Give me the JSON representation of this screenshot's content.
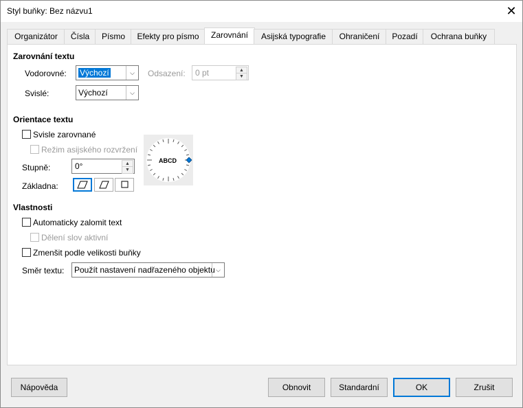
{
  "window": {
    "title": "Styl buňky: Bez názvu1",
    "close_glyph": "✕"
  },
  "tabs": [
    {
      "label": "Organizátor"
    },
    {
      "label": "Čísla"
    },
    {
      "label": "Písmo"
    },
    {
      "label": "Efekty pro písmo"
    },
    {
      "label": "Zarovnání",
      "active": true
    },
    {
      "label": "Asijská typografie"
    },
    {
      "label": "Ohraničení"
    },
    {
      "label": "Pozadí"
    },
    {
      "label": "Ochrana buňky"
    }
  ],
  "alignment": {
    "heading": "Zarovnání textu",
    "horizontal_label": "Vodorovné:",
    "horizontal_value": "Výchozí",
    "indent_label": "Odsazení:",
    "indent_value": "0 pt",
    "vertical_label": "Svislé:",
    "vertical_value": "Výchozí"
  },
  "orientation": {
    "heading": "Orientace textu",
    "vertically_stacked": "Svisle zarovnané",
    "asian_layout": "Režim asijského rozvržení",
    "degrees_label": "Stupně:",
    "degrees_value": "0°",
    "base_label": "Základna:",
    "dial_text": "ABCD"
  },
  "properties": {
    "heading": "Vlastnosti",
    "wrap_text": "Automaticky zalomit text",
    "hyphenation": "Dělení slov aktivní",
    "shrink": "Zmenšit podle velikosti buňky",
    "direction_label": "Směr textu:",
    "direction_value": "Použít nastavení nadřazeného objektu"
  },
  "buttons": {
    "help": "Nápověda",
    "reset": "Obnovit",
    "standard": "Standardní",
    "ok": "OK",
    "cancel": "Zrušit"
  },
  "colors": {
    "accent": "#0078d7"
  }
}
